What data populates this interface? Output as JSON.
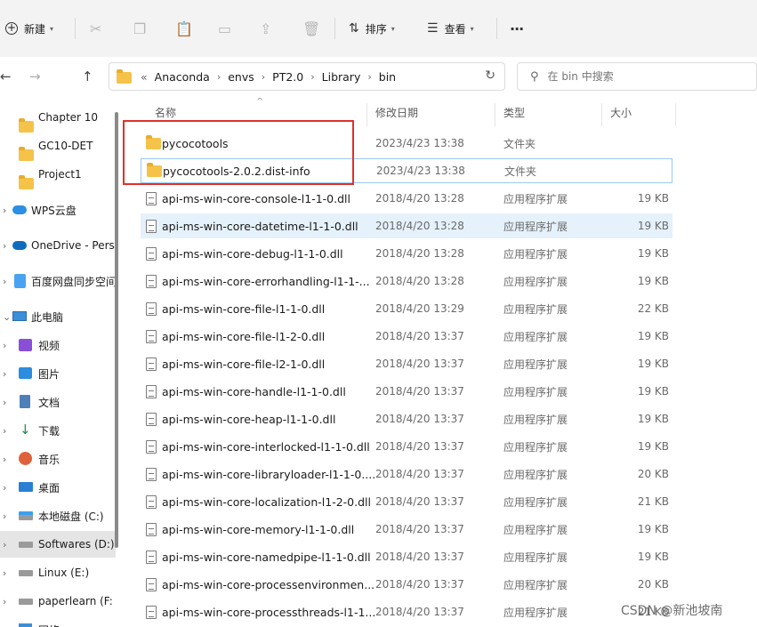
{
  "toolbar": {
    "new_label": "新建",
    "sort_label": "排序",
    "view_label": "查看",
    "more_label": "···"
  },
  "address": {
    "overflow": "«",
    "crumbs": [
      "Anaconda",
      "envs",
      "PT2.0",
      "Library",
      "bin"
    ]
  },
  "search": {
    "placeholder": "在 bin 中搜索"
  },
  "sidebar": {
    "items": [
      {
        "label": "Chapter 10"
      },
      {
        "label": "GC10-DET"
      },
      {
        "label": "Project1"
      },
      {
        "label": "WPS云盘"
      },
      {
        "label": "OneDrive - Pers"
      },
      {
        "label": "百度网盘同步空间"
      },
      {
        "label": "此电脑"
      },
      {
        "label": "视频"
      },
      {
        "label": "图片"
      },
      {
        "label": "文档"
      },
      {
        "label": "下载"
      },
      {
        "label": "音乐"
      },
      {
        "label": "桌面"
      },
      {
        "label": "本地磁盘 (C:)"
      },
      {
        "label": "Softwares (D:)"
      },
      {
        "label": "Linux (E:)"
      },
      {
        "label": "paperlearn (F:"
      },
      {
        "label": "网络"
      }
    ]
  },
  "columns": {
    "name": "名称",
    "date": "修改日期",
    "type": "类型",
    "size": "大小"
  },
  "files": [
    {
      "name": "pycocotools",
      "date": "2023/4/23 13:38",
      "type": "文件夹",
      "size": ""
    },
    {
      "name": "pycocotools-2.0.2.dist-info",
      "date": "2023/4/23 13:38",
      "type": "文件夹",
      "size": ""
    },
    {
      "name": "api-ms-win-core-console-l1-1-0.dll",
      "date": "2018/4/20 13:28",
      "type": "应用程序扩展",
      "size": "19 KB"
    },
    {
      "name": "api-ms-win-core-datetime-l1-1-0.dll",
      "date": "2018/4/20 13:28",
      "type": "应用程序扩展",
      "size": "19 KB"
    },
    {
      "name": "api-ms-win-core-debug-l1-1-0.dll",
      "date": "2018/4/20 13:28",
      "type": "应用程序扩展",
      "size": "19 KB"
    },
    {
      "name": "api-ms-win-core-errorhandling-l1-1-...",
      "date": "2018/4/20 13:28",
      "type": "应用程序扩展",
      "size": "19 KB"
    },
    {
      "name": "api-ms-win-core-file-l1-1-0.dll",
      "date": "2018/4/20 13:29",
      "type": "应用程序扩展",
      "size": "22 KB"
    },
    {
      "name": "api-ms-win-core-file-l1-2-0.dll",
      "date": "2018/4/20 13:37",
      "type": "应用程序扩展",
      "size": "19 KB"
    },
    {
      "name": "api-ms-win-core-file-l2-1-0.dll",
      "date": "2018/4/20 13:37",
      "type": "应用程序扩展",
      "size": "19 KB"
    },
    {
      "name": "api-ms-win-core-handle-l1-1-0.dll",
      "date": "2018/4/20 13:37",
      "type": "应用程序扩展",
      "size": "19 KB"
    },
    {
      "name": "api-ms-win-core-heap-l1-1-0.dll",
      "date": "2018/4/20 13:37",
      "type": "应用程序扩展",
      "size": "19 KB"
    },
    {
      "name": "api-ms-win-core-interlocked-l1-1-0.dll",
      "date": "2018/4/20 13:37",
      "type": "应用程序扩展",
      "size": "19 KB"
    },
    {
      "name": "api-ms-win-core-libraryloader-l1-1-0....",
      "date": "2018/4/20 13:37",
      "type": "应用程序扩展",
      "size": "20 KB"
    },
    {
      "name": "api-ms-win-core-localization-l1-2-0.dll",
      "date": "2018/4/20 13:37",
      "type": "应用程序扩展",
      "size": "21 KB"
    },
    {
      "name": "api-ms-win-core-memory-l1-1-0.dll",
      "date": "2018/4/20 13:37",
      "type": "应用程序扩展",
      "size": "19 KB"
    },
    {
      "name": "api-ms-win-core-namedpipe-l1-1-0.dll",
      "date": "2018/4/20 13:37",
      "type": "应用程序扩展",
      "size": "19 KB"
    },
    {
      "name": "api-ms-win-core-processenvironmen...",
      "date": "2018/4/20 13:37",
      "type": "应用程序扩展",
      "size": "20 KB"
    },
    {
      "name": "api-ms-win-core-processthreads-l1-1...",
      "date": "2018/4/20 13:37",
      "type": "应用程序扩展",
      "size": "21 KB"
    }
  ],
  "watermark": "CSDN @新池坡南"
}
